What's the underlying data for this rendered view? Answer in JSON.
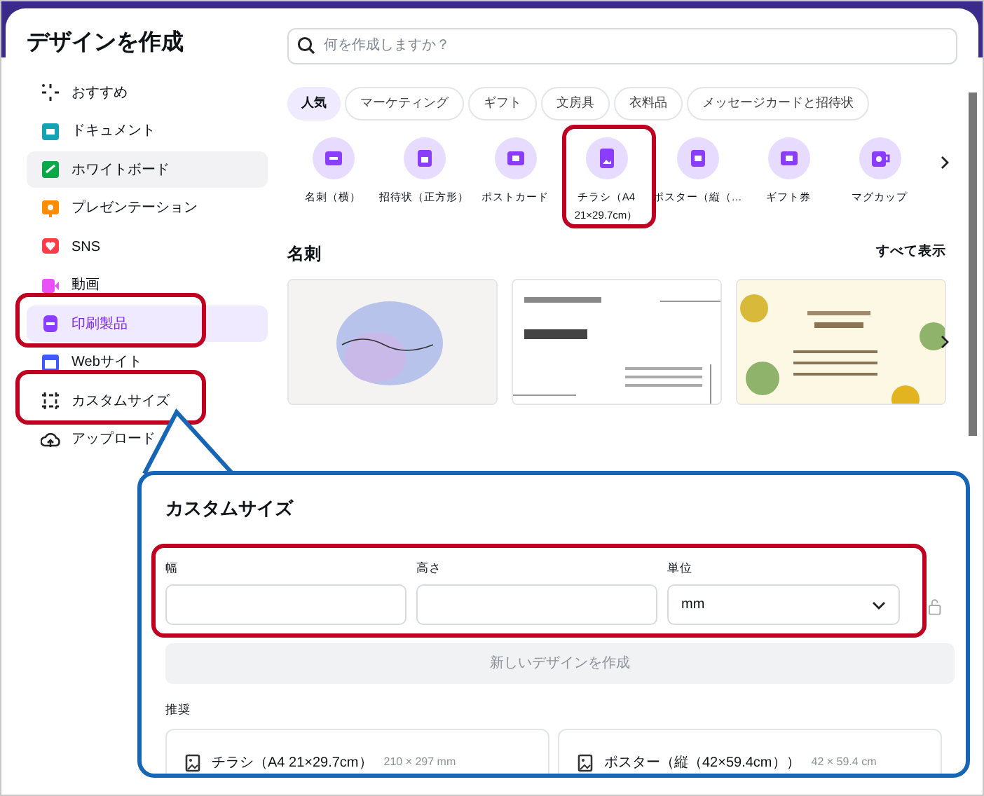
{
  "dialog": {
    "title": "デザインを作成"
  },
  "sidebar": {
    "items": [
      {
        "label": "おすすめ",
        "selected": false,
        "hovered": false,
        "annotated": false
      },
      {
        "label": "ドキュメント",
        "selected": false,
        "hovered": false,
        "annotated": false
      },
      {
        "label": "ホワイトボード",
        "selected": false,
        "hovered": true,
        "annotated": false
      },
      {
        "label": "プレゼンテーション",
        "selected": false,
        "hovered": false,
        "annotated": false
      },
      {
        "label": "SNS",
        "selected": false,
        "hovered": false,
        "annotated": false
      },
      {
        "label": "動画",
        "selected": false,
        "hovered": false,
        "annotated": false
      },
      {
        "label": "印刷製品",
        "selected": true,
        "hovered": false,
        "annotated": true
      },
      {
        "label": "Webサイト",
        "selected": false,
        "hovered": false,
        "annotated": false
      },
      {
        "label": "カスタムサイズ",
        "selected": false,
        "hovered": false,
        "annotated": true
      },
      {
        "label": "アップロード",
        "selected": false,
        "hovered": false,
        "annotated": false
      }
    ]
  },
  "search": {
    "placeholder": "何を作成しますか？"
  },
  "chips": [
    {
      "label": "人気",
      "selected": true
    },
    {
      "label": "マーケティング",
      "selected": false
    },
    {
      "label": "ギフト",
      "selected": false
    },
    {
      "label": "文房具",
      "selected": false
    },
    {
      "label": "衣料品",
      "selected": false
    },
    {
      "label": "メッセージカードと招待状",
      "selected": false
    }
  ],
  "quick_items": [
    {
      "label": "名刺（横）",
      "annotated": false
    },
    {
      "label": "招待状（正方形）",
      "annotated": false
    },
    {
      "label": "ポストカード",
      "annotated": false
    },
    {
      "label": "チラシ（A4 21×29.7cm）",
      "annotated": true
    },
    {
      "label": "ポスター（縦（…",
      "annotated": false
    },
    {
      "label": "ギフト券",
      "annotated": false
    },
    {
      "label": "マグカップ",
      "annotated": false
    }
  ],
  "section": {
    "title": "名刺",
    "link": "すべて表示",
    "thumbnails": [
      {
        "kind": "watercolor"
      },
      {
        "kind": "minimal"
      },
      {
        "kind": "floral"
      }
    ]
  },
  "custom_size": {
    "title": "カスタムサイズ",
    "annotated": true,
    "fields": [
      {
        "label": "幅"
      },
      {
        "label": "高さ"
      }
    ],
    "unit": {
      "label": "単位",
      "value": "mm"
    },
    "create_button": {
      "label": "新しいデザインを作成",
      "disabled": true
    },
    "recommended": {
      "label": "推奨",
      "items": [
        {
          "name": "チラシ（A4 21×29.7cm）",
          "size": "210 × 297 mm"
        },
        {
          "name": "ポスター（縦（42×59.4cm））",
          "size": "42 × 59.4 cm"
        }
      ]
    }
  }
}
